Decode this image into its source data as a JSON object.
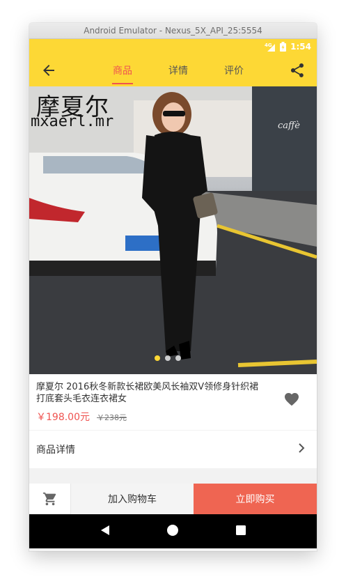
{
  "window": {
    "title": "Android Emulator - Nexus_5X_API_25:5554"
  },
  "status_bar": {
    "network": "4G",
    "time": "1:54"
  },
  "toolbar": {
    "tabs": [
      {
        "label": "商品",
        "active": true
      },
      {
        "label": "详情",
        "active": false
      },
      {
        "label": "评价",
        "active": false
      }
    ]
  },
  "hero": {
    "watermark_cn": "摩夏尔",
    "watermark_en": "mxaerl.mr",
    "slide_count": 3,
    "active_slide": 1
  },
  "product": {
    "name": "摩夏尔 2016秋冬新款长裙欧美风长袖双V领修身针织裙打底套头毛衣连衣裙女",
    "price": "￥198.00元",
    "original_price": "￥238元"
  },
  "detail_row": {
    "label": "商品详情"
  },
  "bottom_bar": {
    "add_to_cart": "加入购物车",
    "buy_now": "立即购买"
  },
  "colors": {
    "primary": "#fdd835",
    "accent": "#ef5350",
    "buy": "#ef6552"
  }
}
